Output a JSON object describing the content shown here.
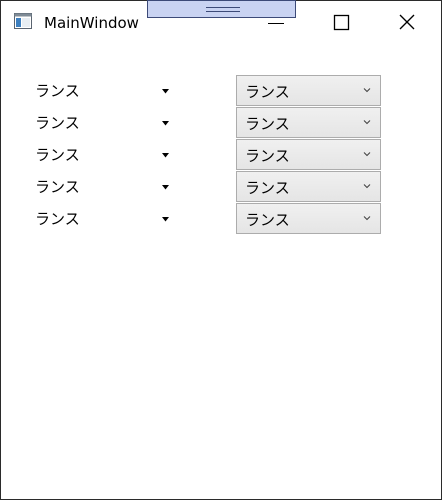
{
  "window": {
    "title": "MainWindow",
    "icon": "app-window-icon",
    "buttons": [
      "minimize-icon",
      "maximize-icon",
      "close-icon"
    ]
  },
  "rows": [
    {
      "label": "ランス",
      "dropdown_value": "ランス"
    },
    {
      "label": "ランス",
      "dropdown_value": "ランス"
    },
    {
      "label": "ランス",
      "dropdown_value": "ランス"
    },
    {
      "label": "ランス",
      "dropdown_value": "ランス"
    },
    {
      "label": "ランス",
      "dropdown_value": "ランス"
    }
  ]
}
